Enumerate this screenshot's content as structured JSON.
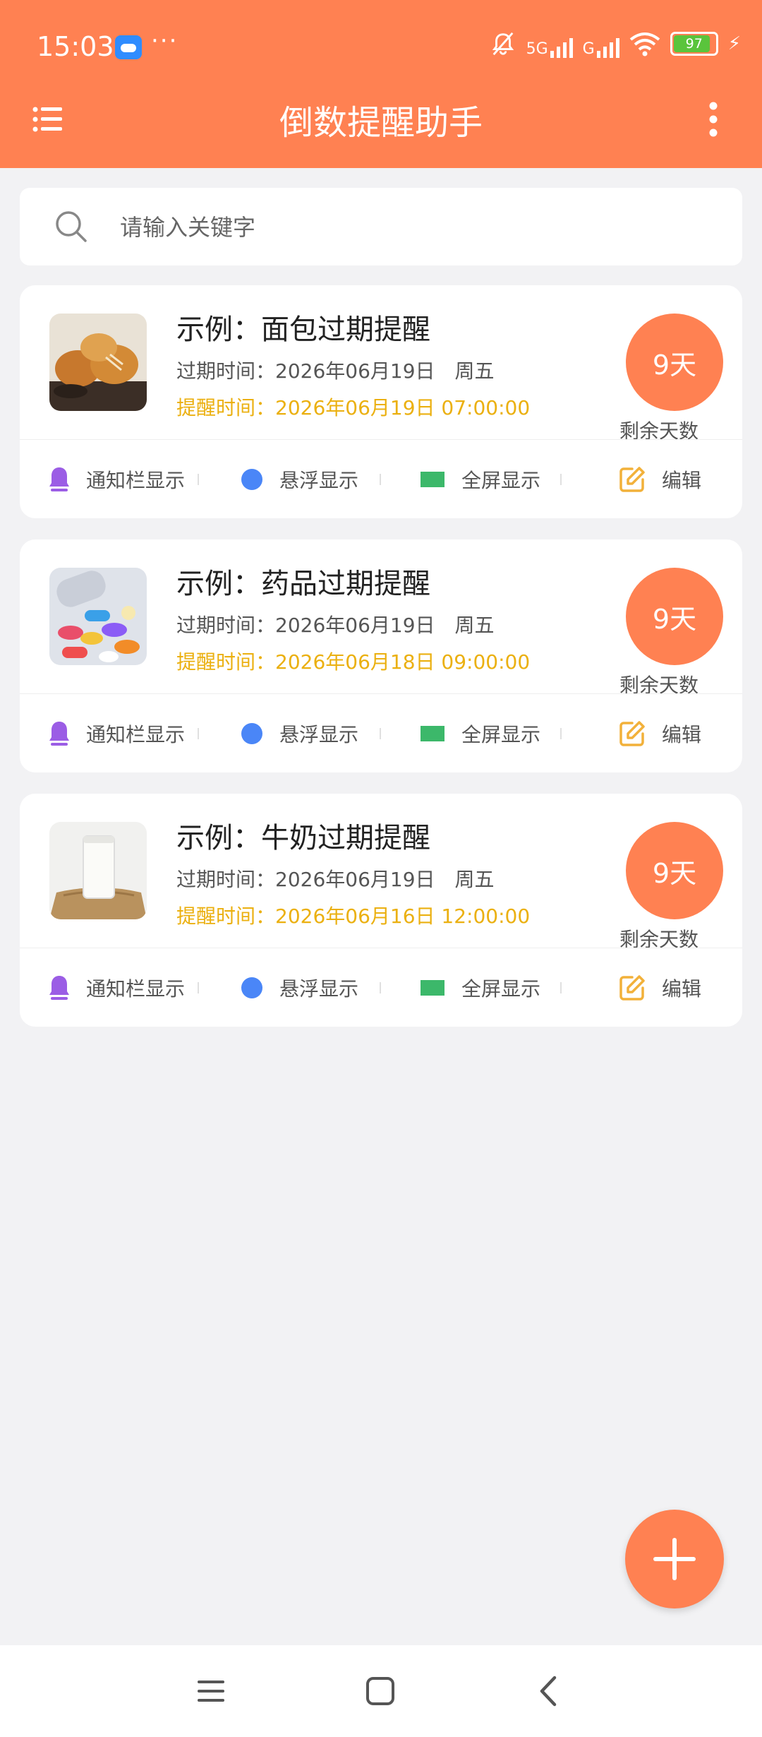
{
  "status": {
    "time": "15:03",
    "dots": "···",
    "net1": "5G",
    "net2": "G",
    "battery": "97",
    "bolt": "⚡"
  },
  "appbar": {
    "title": "倒数提醒助手"
  },
  "search": {
    "placeholder": "请输入关键字"
  },
  "cards": [
    {
      "title": "示例：面包过期提醒",
      "expire": "过期时间：2026年06月19日　周五",
      "remind": "提醒时间：2026年06月19日 07:00:00",
      "days": "9天",
      "days_label": "剩余天数",
      "thumb": "bread"
    },
    {
      "title": "示例：药品过期提醒",
      "expire": "过期时间：2026年06月19日　周五",
      "remind": "提醒时间：2026年06月18日 09:00:00",
      "days": "9天",
      "days_label": "剩余天数",
      "thumb": "pills"
    },
    {
      "title": "示例：牛奶过期提醒",
      "expire": "过期时间：2026年06月19日　周五",
      "remind": "提醒时间：2026年06月16日 12:00:00",
      "days": "9天",
      "days_label": "剩余天数",
      "thumb": "milk"
    }
  ],
  "actions": {
    "notify": "通知栏显示",
    "float": "悬浮显示",
    "fullscreen": "全屏显示",
    "edit": "编辑"
  },
  "colors": {
    "accent": "#ff8152",
    "remind": "#ebb010",
    "notify_icon": "#9b5de5",
    "float_icon": "#4a86f7",
    "fullscreen_icon": "#3cb86a",
    "edit_icon": "#f2b13a"
  },
  "icons": {
    "menu": "menu-icon",
    "more": "more-vertical-icon",
    "search": "search-icon",
    "add": "plus-icon"
  }
}
